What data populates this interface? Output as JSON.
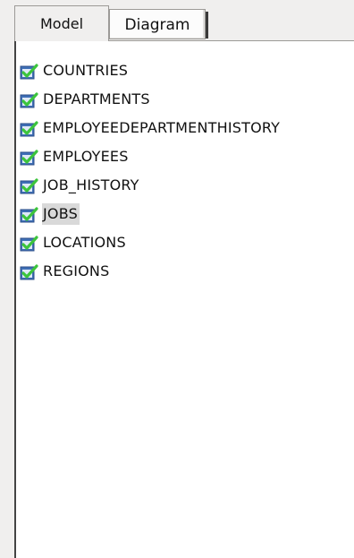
{
  "tabs": {
    "model_label": "Model",
    "diagram_label": "Diagram"
  },
  "tree": {
    "items": [
      {
        "label": "COUNTRIES",
        "checked": true
      },
      {
        "label": "DEPARTMENTS",
        "checked": true
      },
      {
        "label": "EMPLOYEEDEPARTMENTHISTORY",
        "checked": true
      },
      {
        "label": "EMPLOYEES",
        "checked": true
      },
      {
        "label": "JOB_HISTORY",
        "checked": true
      },
      {
        "label": "JOBS",
        "checked": true,
        "selected": true
      },
      {
        "label": "LOCATIONS",
        "checked": true
      },
      {
        "label": "REGIONS",
        "checked": true
      }
    ]
  },
  "colors": {
    "checkbox_fill": "#3f6fb6",
    "check_mark": "#3cc43c",
    "selection": "#d9d9d9",
    "background": "#f0efee"
  }
}
